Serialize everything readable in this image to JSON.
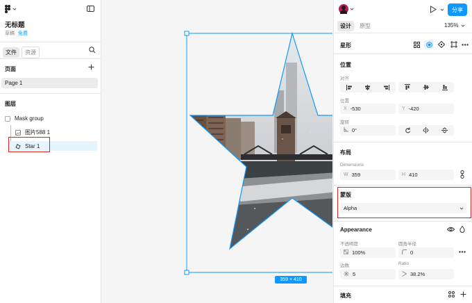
{
  "file": {
    "title": "无标题",
    "drafts": "草稿",
    "plan": "免费"
  },
  "left_tabs": {
    "file": "文件",
    "assets": "资源"
  },
  "pages": {
    "title": "页面",
    "current": "Page 1"
  },
  "layers": {
    "title": "图层",
    "items": [
      {
        "name": "Mask group"
      },
      {
        "name": "图片588 1"
      },
      {
        "name": "Star 1"
      }
    ]
  },
  "canvas": {
    "size_badge": "359 × 410"
  },
  "top": {
    "share": "分享",
    "design_tab": "设计",
    "prototype_tab": "原型",
    "zoom": "135%"
  },
  "shape": {
    "title": "星形"
  },
  "position": {
    "title": "位置",
    "align_label": "对齐",
    "pos_label": "位置",
    "x_label": "X",
    "x": "-530",
    "y_label": "Y",
    "y": "-420",
    "rotation_label": "旋转",
    "rotation": "0°"
  },
  "layout": {
    "title": "布局",
    "dimensions_label": "Dimensions",
    "w_label": "W",
    "w": "359",
    "h_label": "H",
    "h": "410"
  },
  "mask": {
    "title": "蒙版",
    "value": "Alpha"
  },
  "appearance": {
    "title": "Appearance",
    "opacity_label": "不透明度",
    "opacity": "100%",
    "radius_label": "圆角半径",
    "radius": "0",
    "count_label": "边数",
    "count": "5",
    "ratio_label": "Ratio",
    "ratio": "38.2%"
  },
  "fill": {
    "title": "填充"
  },
  "colors": {
    "accent": "#0d99ff",
    "highlight": "#e02020",
    "selection_bg": "#e5f4ff"
  }
}
